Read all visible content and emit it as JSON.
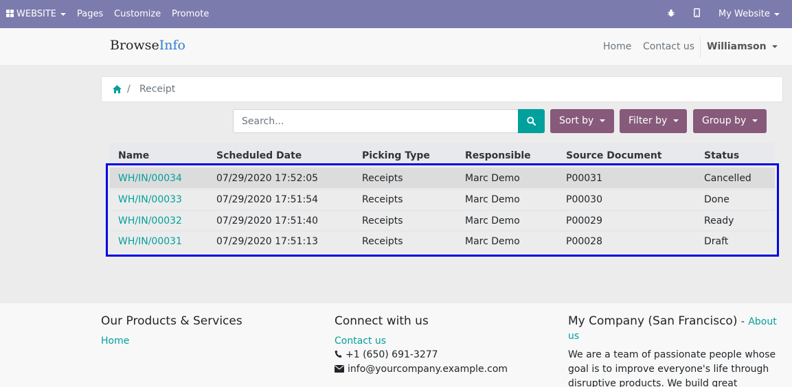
{
  "adminbar": {
    "website_label": "WEBSITE",
    "pages_label": "Pages",
    "customize_label": "Customize",
    "promote_label": "Promote",
    "my_website_label": "My Website"
  },
  "header": {
    "logo_part1": "Browse",
    "logo_part2": "Info",
    "nav": {
      "home": "Home",
      "contact": "Contact us"
    },
    "user": "Williamson"
  },
  "breadcrumb": {
    "separator": "/",
    "current": "Receipt"
  },
  "search": {
    "placeholder": "Search...",
    "value": ""
  },
  "buttons": {
    "sort": "Sort by",
    "filter": "Filter by",
    "group": "Group by"
  },
  "table": {
    "headers": {
      "name": "Name",
      "date": "Scheduled Date",
      "picking": "Picking Type",
      "responsible": "Responsible",
      "source": "Source Document",
      "status": "Status"
    },
    "rows": [
      {
        "name": "WH/IN/00034",
        "date": "07/29/2020 17:52:05",
        "picking": "Receipts",
        "responsible": "Marc Demo",
        "source": "P00031",
        "status": "Cancelled"
      },
      {
        "name": "WH/IN/00033",
        "date": "07/29/2020 17:51:54",
        "picking": "Receipts",
        "responsible": "Marc Demo",
        "source": "P00030",
        "status": "Done"
      },
      {
        "name": "WH/IN/00032",
        "date": "07/29/2020 17:51:40",
        "picking": "Receipts",
        "responsible": "Marc Demo",
        "source": "P00029",
        "status": "Ready"
      },
      {
        "name": "WH/IN/00031",
        "date": "07/29/2020 17:51:13",
        "picking": "Receipts",
        "responsible": "Marc Demo",
        "source": "P00028",
        "status": "Draft"
      }
    ]
  },
  "footer": {
    "products_title": "Our Products & Services",
    "products_home": "Home",
    "connect_title": "Connect with us",
    "connect_contact": "Contact us",
    "phone": "+1 (650) 691-3277",
    "email": "info@yourcompany.example.com",
    "company_title": "My Company (San Francisco)",
    "company_sep": "-",
    "about_part1": "About",
    "about_part2": "us",
    "about_line1": "We are a team of passionate people whose",
    "about_line2": "goal is to improve everyone's life through",
    "about_line3": "disruptive products. We build great"
  },
  "colors": {
    "admin_bar": "#7c7bad",
    "accent": "#00a09d",
    "button": "#875a7b",
    "highlight": "#0000e0"
  }
}
